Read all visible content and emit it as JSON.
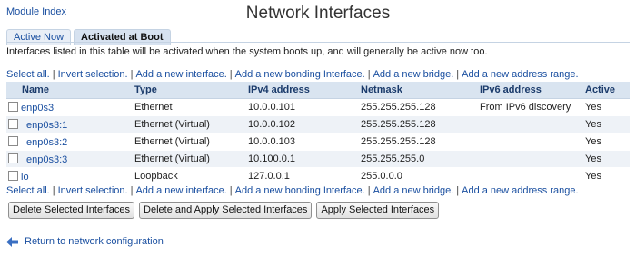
{
  "module_index_label": "Module Index",
  "page_title": "Network Interfaces",
  "tabs": [
    {
      "label": "Active Now",
      "active": false
    },
    {
      "label": "Activated at Boot",
      "active": true
    }
  ],
  "description": "Interfaces listed in this table will be activated when the system boots up, and will generally be active now too.",
  "actions": {
    "select_all": "Select all.",
    "invert_selection": "Invert selection.",
    "add_interface": "Add a new interface.",
    "add_bonding": "Add a new bonding Interface.",
    "add_bridge": "Add a new bridge.",
    "add_address_range": "Add a new address range.",
    "separator": "|"
  },
  "table": {
    "columns": [
      "Name",
      "Type",
      "IPv4 address",
      "Netmask",
      "IPv6 address",
      "Active"
    ],
    "rows": [
      {
        "name": "enp0s3",
        "type": "Ethernet",
        "ipv4": "10.0.0.101",
        "netmask": "255.255.255.128",
        "ipv6": "From IPv6 discovery",
        "active": "Yes"
      },
      {
        "name": "enp0s3:1",
        "type": "Ethernet (Virtual)",
        "ipv4": "10.0.0.102",
        "netmask": "255.255.255.128",
        "ipv6": "",
        "active": "Yes"
      },
      {
        "name": "enp0s3:2",
        "type": "Ethernet (Virtual)",
        "ipv4": "10.0.0.103",
        "netmask": "255.255.255.128",
        "ipv6": "",
        "active": "Yes"
      },
      {
        "name": "enp0s3:3",
        "type": "Ethernet (Virtual)",
        "ipv4": "10.100.0.1",
        "netmask": "255.255.255.0",
        "ipv6": "",
        "active": "Yes"
      },
      {
        "name": "lo",
        "type": "Loopback",
        "ipv4": "127.0.0.1",
        "netmask": "255.0.0.0",
        "ipv6": "",
        "active": "Yes"
      }
    ]
  },
  "buttons": {
    "delete_selected": "Delete Selected Interfaces",
    "delete_apply_selected": "Delete and Apply Selected Interfaces",
    "apply_selected": "Apply Selected Interfaces"
  },
  "return_link": "Return to network configuration",
  "colors": {
    "link": "#1a4fa0",
    "header_bg": "#d9e4f0",
    "row_alt_bg": "#eef2f7",
    "back_arrow": "#3a6fc2"
  },
  "icons": {
    "back": "back-arrow-icon"
  }
}
